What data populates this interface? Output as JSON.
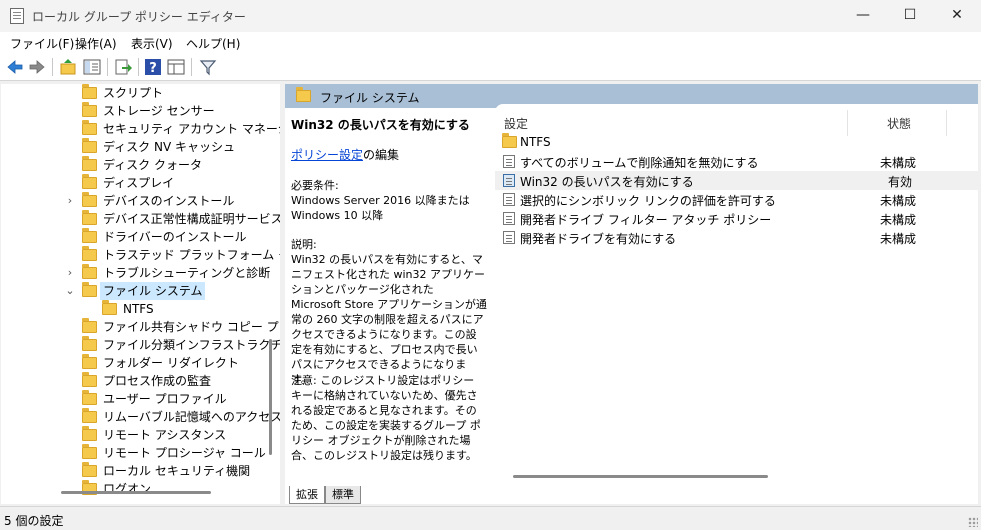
{
  "window": {
    "title": "ローカル グループ ポリシー エディター",
    "minimize": "—",
    "maximize": "☐",
    "close": "✕"
  },
  "menu": [
    "ファイル(F)",
    "操作(A)",
    "表示(V)",
    "ヘルプ(H)"
  ],
  "tree": {
    "items": [
      {
        "label": "スクリプト",
        "expander": ""
      },
      {
        "label": "ストレージ センサー",
        "expander": ""
      },
      {
        "label": "セキュリティ アカウント マネージャー",
        "expander": ""
      },
      {
        "label": "ディスク NV キャッシュ",
        "expander": ""
      },
      {
        "label": "ディスク クォータ",
        "expander": ""
      },
      {
        "label": "ディスプレイ",
        "expander": ""
      },
      {
        "label": "デバイスのインストール",
        "expander": "›"
      },
      {
        "label": "デバイス正常性構成証明サービス",
        "expander": ""
      },
      {
        "label": "ドライバーのインストール",
        "expander": ""
      },
      {
        "label": "トラステッド プラットフォーム モジュール",
        "expander": ""
      },
      {
        "label": "トラブルシューティングと診断",
        "expander": "›"
      },
      {
        "label": "ファイル システム",
        "expander": "⌄"
      },
      {
        "label": "NTFS",
        "expander": ""
      },
      {
        "label": "ファイル共有シャドウ コピー プロバイダー",
        "expander": ""
      },
      {
        "label": "ファイル分類インフラストラクチャ",
        "expander": ""
      },
      {
        "label": "フォルダー リダイレクト",
        "expander": ""
      },
      {
        "label": "プロセス作成の監査",
        "expander": ""
      },
      {
        "label": "ユーザー プロファイル",
        "expander": ""
      },
      {
        "label": "リムーバブル記憶域へのアクセス",
        "expander": ""
      },
      {
        "label": "リモート アシスタンス",
        "expander": ""
      },
      {
        "label": "リモート プロシージャ コール",
        "expander": ""
      },
      {
        "label": "ローカル セキュリティ機関",
        "expander": ""
      },
      {
        "label": "ログオン",
        "expander": ""
      }
    ]
  },
  "right": {
    "header": "ファイル システム",
    "extended": {
      "title": "Win32 の長いパスを有効にする",
      "edit_link": "ポリシー設定",
      "edit_suffix": "の編集",
      "requirements": "必要条件:\nWindows Server 2016 以降または Windows 10 以降",
      "description": "説明:\nWin32 の長いパスを有効にすると、マニフェスト化された win32 アプリケーションとパッケージ化された Microsoft Store アプリケーションが通常の 260 文字の制限を超えるパスにアクセスできるようになります。この設定を有効にすると、プロセス内で長いパスにアクセスできるようになります。",
      "note": "注意: このレジストリ設定はポリシー キーに格納されていないため、優先される設定であると見なされます。そのため、この設定を実装するグループ ポリシー オブジェクトが削除された場合、このレジストリ設定は残ります。"
    },
    "columns": {
      "setting": "設定",
      "state": "状態"
    },
    "rows": [
      {
        "label": "NTFS",
        "state": "",
        "type": "folder"
      },
      {
        "label": "すべてのボリュームで削除通知を無効にする",
        "state": "未構成",
        "type": "policy"
      },
      {
        "label": "Win32 の長いパスを有効にする",
        "state": "有効",
        "type": "policy-active"
      },
      {
        "label": "選択的にシンボリック リンクの評価を許可する",
        "state": "未構成",
        "type": "policy"
      },
      {
        "label": "開発者ドライブ フィルター アタッチ ポリシー",
        "state": "未構成",
        "type": "policy"
      },
      {
        "label": "開発者ドライブを有効にする",
        "state": "未構成",
        "type": "policy"
      }
    ]
  },
  "tabs": [
    "拡張",
    "標準"
  ],
  "status": "5 個の設定"
}
